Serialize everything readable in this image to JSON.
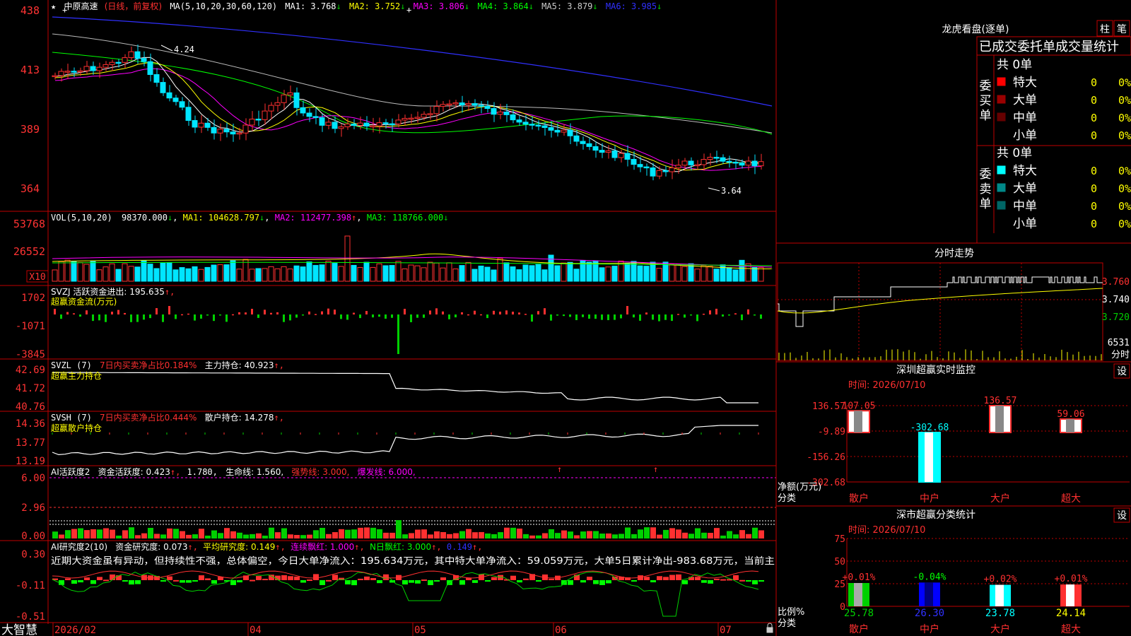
{
  "colors": {
    "bg": "#000000",
    "frame": "#c00000",
    "up": "#ff3030",
    "down": "#00e5ff",
    "green": "#00d000",
    "white": "#ffffff",
    "yellow": "#ffff00",
    "magenta": "#ff00ff",
    "blue": "#3030ff",
    "lime": "#00ff00",
    "axis": "#ff3333"
  },
  "stock": {
    "star": "★",
    "name": "中原高速",
    "period": "(日线，前复权)"
  },
  "ma": {
    "head": "MA(5,10,20,30,60,120)",
    "items": [
      {
        "label": "MA1: 3.768",
        "arrow": "↓",
        "color": "#ffffff"
      },
      {
        "label": "MA2: 3.752",
        "arrow": "↓",
        "color": "#ffff00"
      },
      {
        "label": "MA3: 3.806",
        "arrow": "↓",
        "color": "#ff00ff"
      },
      {
        "label": "MA4: 3.864",
        "arrow": "↓",
        "color": "#00ff00"
      },
      {
        "label": "MA5: 3.879",
        "arrow": "↓",
        "color": "#cccccc"
      },
      {
        "label": "MA6: 3.985",
        "arrow": "↓",
        "color": "#3030ff"
      }
    ]
  },
  "price_axis": {
    "labels": [
      "438",
      "413",
      "389",
      "364"
    ]
  },
  "price_marks": {
    "high": "4.24",
    "low": "3.64"
  },
  "volume": {
    "header": "VOL(5,10,20)",
    "value": "98370.000",
    "arrow": "↓",
    "ma1": "MA1: 104628.797",
    "ma1_arrow": "↓",
    "ma2": "MA2: 112477.398",
    "ma2_arrow": "↑",
    "ma3": "MA3: 118766.000",
    "ma3_arrow": "↓",
    "axis": [
      "53768",
      "26552"
    ],
    "unit": "X10"
  },
  "svzj": {
    "header": "SVZJ  活跃资金进出: 195.635",
    "arrow": "↑,",
    "sub": "超赢资金流(万元)",
    "axis": [
      "1702",
      "-1071",
      "-3845"
    ]
  },
  "svzl": {
    "name": "SVZL (7)",
    "net": "7日内买卖净占比0.184%",
    "hold": "主力持仓: 40.923",
    "arrow": "↑,",
    "sub": "超赢主力持仓",
    "axis": [
      "42.69",
      "41.72",
      "40.76"
    ]
  },
  "svsh": {
    "name": "SVSH (7)",
    "net": "7日内买卖净占比0.444%",
    "hold": "散户持仓: 14.278",
    "arrow": "↑,",
    "sub": "超赢散户持仓",
    "axis": [
      "14.36",
      "13.77",
      "13.19"
    ]
  },
  "ai1": {
    "name": "AI活跃度2",
    "a": "资金活跃度: 0.423",
    "a_arrow": "↑,",
    "b": "1.780,",
    "c": "生命线: 1.560,",
    "d": "强势线: 3.000,",
    "e": "爆发线: 6.000,",
    "axis": [
      "6.00",
      "2.96",
      "0.00"
    ]
  },
  "ai2": {
    "name": "AI研究度2(10)",
    "a": "资金研究度: 0.073",
    "a_arrow": "↑,",
    "b": "平均研究度: 0.149",
    "b_arrow": "↑,",
    "c": "连续飘红: 1.000",
    "c_arrow": "↑,",
    "d": "N日飘红: 3.000",
    "d_arrow": "↑,",
    "e": "0.149",
    "e_arrow": "↑,",
    "note": "近期大资金虽有异动，但持续性不强，总体偏空，今日大单净流入：195.634万元，其中特大单净流入：59.059万元，大单5日累计净出-983.68万元，当前主",
    "axis": [
      "0.30",
      "-0.11",
      "-0.51"
    ]
  },
  "dates": [
    "2026/02",
    "04",
    "05",
    "06",
    "07"
  ],
  "brand": "大智慧",
  "dragon": {
    "title": "龙虎看盘(逐单)",
    "btn1": "柱",
    "btn2": "笔",
    "header": "已成交委托单成交量统计",
    "buy": {
      "label": [
        "委",
        "买",
        "单"
      ],
      "total": "共 0单",
      "rows": [
        {
          "name": "特大",
          "count": "0",
          "pct": "0%",
          "color": "#ff0000"
        },
        {
          "name": "大单",
          "count": "0",
          "pct": "0%",
          "color": "#990000"
        },
        {
          "name": "中单",
          "count": "0",
          "pct": "0%",
          "color": "#660000"
        },
        {
          "name": "小单",
          "count": "0",
          "pct": "0%",
          "color": "#000000"
        }
      ]
    },
    "sell": {
      "label": [
        "委",
        "卖",
        "单"
      ],
      "total": "共 0单",
      "rows": [
        {
          "name": "特大",
          "count": "0",
          "pct": "0%",
          "color": "#00ffff"
        },
        {
          "name": "大单",
          "count": "0",
          "pct": "0%",
          "color": "#008888"
        },
        {
          "name": "中单",
          "count": "0",
          "pct": "0%",
          "color": "#006666"
        },
        {
          "name": "小单",
          "count": "0",
          "pct": "0%",
          "color": "#000000"
        }
      ]
    }
  },
  "intraday": {
    "title": "分时走势",
    "axis": [
      "3.760",
      "3.740",
      "3.720"
    ],
    "vol": "6531",
    "vol_label": "分时"
  },
  "sz_monitor": {
    "title": "深圳超赢实时监控",
    "set": "设",
    "time": "时间: 2026/07/10",
    "axis": [
      "136.57",
      "-9.89",
      "-156.26",
      "-302.68"
    ],
    "ylabel": "净额(万元)",
    "xlabel": "分类"
  },
  "sz_class": {
    "title": "深市超赢分类统计",
    "set": "设",
    "time": "时间: 2026/07/10",
    "axis": [
      "75",
      "50",
      "25",
      "0"
    ],
    "ylabel": "比例%",
    "xlabel": "分类"
  },
  "chart_data": [
    {
      "type": "bar",
      "title": "深圳超赢实时监控",
      "ylabel": "净额(万元)",
      "xlabel": "分类",
      "categories": [
        "散户",
        "中户",
        "大户",
        "超大"
      ],
      "values": [
        107.05,
        -302.68,
        136.57,
        59.06
      ],
      "ylim": [
        -302.68,
        136.57
      ]
    },
    {
      "type": "bar",
      "title": "深市超赢分类统计",
      "ylabel": "比例%",
      "xlabel": "分类",
      "categories": [
        "散户",
        "中户",
        "大户",
        "超大"
      ],
      "values": [
        25.78,
        26.3,
        23.78,
        24.14
      ],
      "changes": [
        "+0.01%",
        "-0.04%",
        "+0.02%",
        "+0.01%"
      ],
      "ylim": [
        0,
        75
      ]
    }
  ]
}
